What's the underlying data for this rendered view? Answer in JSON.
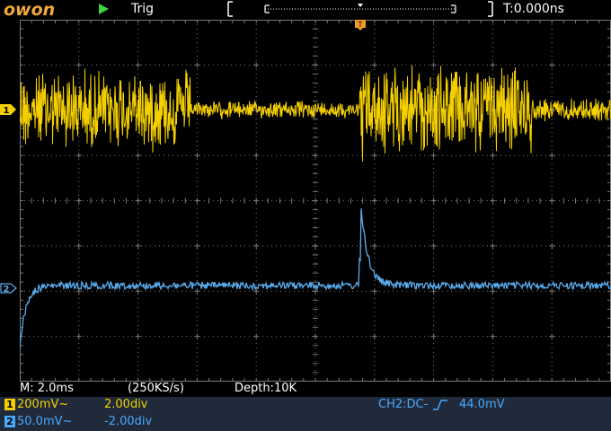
{
  "header": {
    "logo": "owon",
    "run_state_icon": "play-icon",
    "trigger_status": "Trig",
    "time_position": "T:0.000ns"
  },
  "markers": {
    "trigger_top": "T",
    "ch1": "1",
    "ch2": "2"
  },
  "status_bar": {
    "timebase": "M: 2.0ms",
    "sample_rate": "(250KS/s)",
    "depth": "Depth:10K"
  },
  "channels": [
    {
      "number": "1",
      "scale": "200mV~",
      "offset": "2.00div",
      "color": "#f5d000"
    },
    {
      "number": "2",
      "scale": "50.0mV~",
      "offset": "-2.00div",
      "color": "#4aa8ff"
    }
  ],
  "trigger_info": {
    "source": "CH2:DC-",
    "level": "44.0mV"
  },
  "colors": {
    "ch1": "#f5d000",
    "ch2": "#5aaef0",
    "grid": "#7a7a7a",
    "trigger": "#f29a2e",
    "status_panel": "#202a3a"
  }
}
